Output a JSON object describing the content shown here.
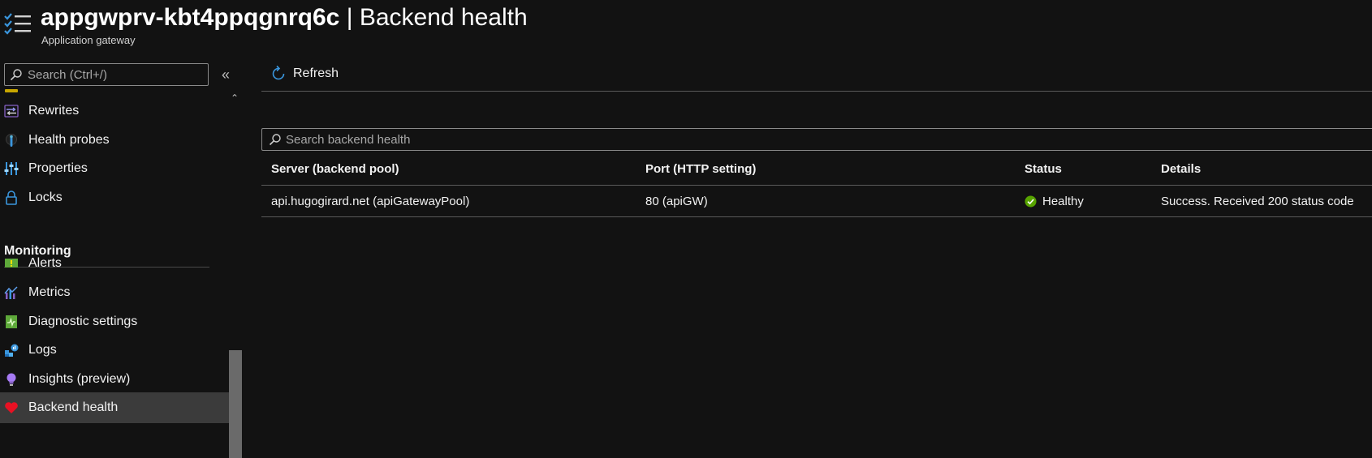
{
  "header": {
    "resource_name": "appgwprv-kbt4ppqgnrq6c",
    "separator": " | ",
    "page_name": "Backend health",
    "subtitle": "Application gateway",
    "icon": "menu-list-icon"
  },
  "sidebar": {
    "search_placeholder": "Search (Ctrl+/)",
    "collapse_icon": "double-chevron-left-icon",
    "items_top": [
      {
        "label": "Rewrites",
        "icon": "rewrites-icon"
      },
      {
        "label": "Health probes",
        "icon": "health-probe-icon"
      },
      {
        "label": "Properties",
        "icon": "properties-icon"
      },
      {
        "label": "Locks",
        "icon": "lock-icon"
      }
    ],
    "section_title": "Monitoring",
    "items_monitoring": [
      {
        "label": "Alerts",
        "icon": "alert-icon"
      },
      {
        "label": "Metrics",
        "icon": "metrics-icon"
      },
      {
        "label": "Diagnostic settings",
        "icon": "diagnostic-settings-icon"
      },
      {
        "label": "Logs",
        "icon": "logs-icon"
      },
      {
        "label": "Insights (preview)",
        "icon": "insights-bulb-icon"
      },
      {
        "label": "Backend health",
        "icon": "heart-icon",
        "active": true
      }
    ]
  },
  "toolbar": {
    "refresh_label": "Refresh",
    "refresh_icon": "refresh-icon"
  },
  "main": {
    "search_placeholder": "Search backend health",
    "columns": [
      "Server (backend pool)",
      "Port (HTTP setting)",
      "Status",
      "Details"
    ],
    "rows": [
      {
        "server": "api.hugogirard.net (apiGatewayPool)",
        "port": "80 (apiGW)",
        "status": "Healthy",
        "details": "Success. Received 200 status code"
      }
    ]
  },
  "colors": {
    "background": "#121212",
    "active_item": "#3b3b3b",
    "healthy": "#57a300",
    "accent_blue": "#3a96dd"
  }
}
